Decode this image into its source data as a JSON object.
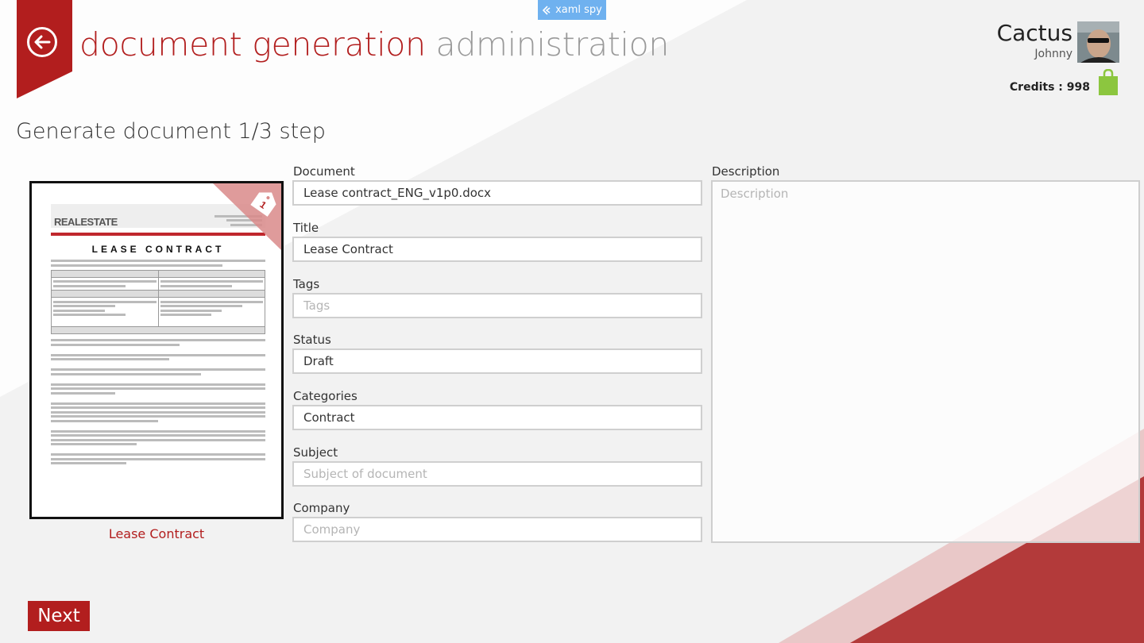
{
  "app": {
    "debug_badge": "xaml spy"
  },
  "header": {
    "title_main": "document generation",
    "title_secondary": "administration",
    "back_label": "back"
  },
  "user": {
    "first_name": "Cactus",
    "last_name": "Johnny",
    "credits_label": "Credits : 998"
  },
  "step_title": "Generate document 1/3 step",
  "preview": {
    "caption": "Lease Contract",
    "ribbon_number": "1",
    "doc_heading": "LEASE CONTRACT",
    "logo_a": "REAL",
    "logo_b": "ESTATE"
  },
  "form": {
    "document": {
      "label": "Document",
      "value": "Lease contract_ENG_v1p0.docx",
      "placeholder": ""
    },
    "title": {
      "label": "Title",
      "value": "Lease Contract",
      "placeholder": ""
    },
    "tags": {
      "label": "Tags",
      "value": "",
      "placeholder": "Tags"
    },
    "status": {
      "label": "Status",
      "value": "Draft",
      "placeholder": ""
    },
    "categories": {
      "label": "Categories",
      "value": "Contract",
      "placeholder": ""
    },
    "subject": {
      "label": "Subject",
      "value": "",
      "placeholder": "Subject of document"
    },
    "company": {
      "label": "Company",
      "value": "",
      "placeholder": "Company"
    },
    "description": {
      "label": "Description",
      "value": "",
      "placeholder": "Description"
    }
  },
  "actions": {
    "next_label": "Next"
  },
  "colors": {
    "accent": "#b21e1e",
    "badge": "#6fb1ef",
    "bag": "#8cc63f"
  }
}
